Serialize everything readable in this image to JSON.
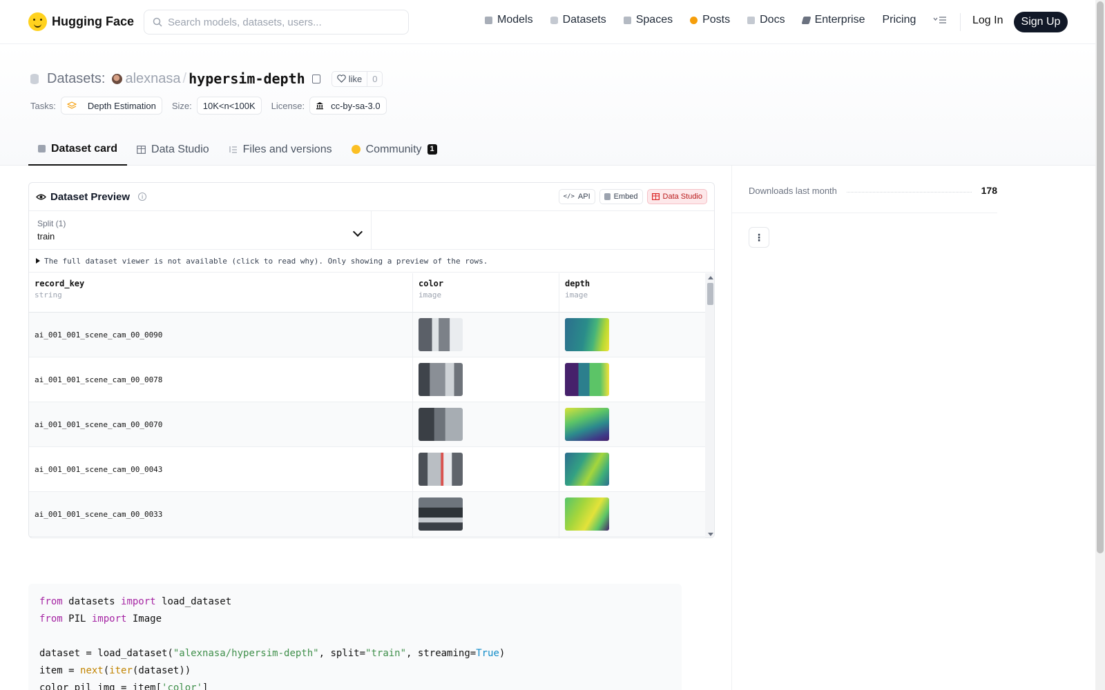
{
  "nav": {
    "brand": "Hugging Face",
    "search_placeholder": "Search models, datasets, users...",
    "links": [
      {
        "label": "Models",
        "icon": "cube-icon",
        "color": "#9ca3af"
      },
      {
        "label": "Datasets",
        "icon": "database-icon",
        "color": "#9ca3af"
      },
      {
        "label": "Spaces",
        "icon": "grid-icon",
        "color": "#9ca3af"
      },
      {
        "label": "Posts",
        "icon": "chat-bubble-icon",
        "color": "#f59e0b"
      },
      {
        "label": "Docs",
        "icon": "book-icon",
        "color": "#9ca3af"
      },
      {
        "label": "Enterprise",
        "icon": "briefcase-icon",
        "color": "#6b7280"
      },
      {
        "label": "Pricing",
        "icon": "",
        "color": ""
      }
    ],
    "login": "Log In",
    "signup": "Sign Up"
  },
  "header": {
    "crumb_label": "Datasets:",
    "owner": "alexnasa",
    "dataset_name": "hypersim-depth",
    "like_label": "like",
    "like_count": "0",
    "tasks_key": "Tasks:",
    "task": "Depth Estimation",
    "size_key": "Size:",
    "size": "10K<n<100K",
    "license_key": "License:",
    "license": "cc-by-sa-3.0"
  },
  "tabs": [
    {
      "label": "Dataset card",
      "active": true
    },
    {
      "label": "Data Studio",
      "active": false
    },
    {
      "label": "Files and versions",
      "active": false
    },
    {
      "label": "Community",
      "active": false,
      "badge": "1"
    }
  ],
  "preview": {
    "title": "Dataset Preview",
    "api": "API",
    "embed": "Embed",
    "studio": "Data Studio",
    "split_label": "Split (1)",
    "split_value": "train",
    "notice": "The full dataset viewer is not available (click to read why). Only showing a preview of the rows.",
    "columns": [
      {
        "name": "record_key",
        "type": "string"
      },
      {
        "name": "color",
        "type": "image"
      },
      {
        "name": "depth",
        "type": "image"
      }
    ],
    "rows": [
      {
        "key": "ai_001_001_scene_cam_00_0090"
      },
      {
        "key": "ai_001_001_scene_cam_00_0078"
      },
      {
        "key": "ai_001_001_scene_cam_00_0070"
      },
      {
        "key": "ai_001_001_scene_cam_00_0043"
      },
      {
        "key": "ai_001_001_scene_cam_00_0033"
      }
    ]
  },
  "code": {
    "l1_kw1": "from",
    "l1_mod": " datasets ",
    "l1_kw2": "import",
    "l1_name": " load_dataset",
    "l2_kw1": "from",
    "l2_mod": " PIL ",
    "l2_kw2": "import",
    "l2_name": " Image",
    "l3_a": "dataset = load_dataset(",
    "l3_s1": "\"alexnasa/hypersim-depth\"",
    "l3_b": ", split=",
    "l3_s2": "\"train\"",
    "l3_c": ", streaming=",
    "l3_t": "True",
    "l3_d": ")",
    "l4_a": "item = ",
    "l4_b1": "next",
    "l4_b": "(",
    "l4_b2": "iter",
    "l4_c": "(dataset))",
    "l5_a": "color_pil_img = item[",
    "l5_s": "'color'",
    "l5_b": "]"
  },
  "sidebar": {
    "downloads_label": "Downloads last month",
    "downloads_value": "178"
  }
}
